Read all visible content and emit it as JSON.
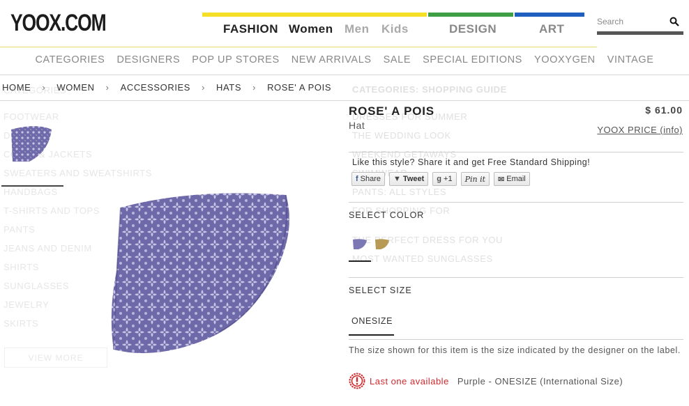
{
  "brand": {
    "logo_text": "YOOX.COM"
  },
  "topnav": {
    "fashion": "FASHION",
    "women": "Women",
    "men": "Men",
    "kids": "Kids",
    "design": "DESIGN",
    "art": "ART",
    "colors": {
      "fashion": "#f5e027",
      "design": "#3f9f46",
      "art": "#1f5fc0",
      "active": "#222222",
      "inactive": "#a9a9a9"
    }
  },
  "search": {
    "placeholder": "Search",
    "icon": "search-icon"
  },
  "catnav": [
    "CATEGORIES",
    "DESIGNERS",
    "POP UP STORES",
    "NEW ARRIVALS",
    "SALE",
    "SPECIAL EDITIONS",
    "YOOXYGEN",
    "VINTAGE"
  ],
  "breadcrumb": [
    "HOME",
    "WOMEN",
    "ACCESSORIES",
    "HATS",
    "ROSE' A POIS"
  ],
  "breadcrumb_separator": "›",
  "background_menu_left": [
    "CATEGORIES",
    "FOOTWEAR",
    "DRESSES",
    "COATS & JACKETS",
    "SWEATERS AND SWEATSHIRTS",
    "HANDBAGS",
    "T-SHIRTS AND TOPS",
    "PANTS",
    "JEANS AND DENIM",
    "SHIRTS",
    "SUNGLASSES",
    "JEWELRY",
    "SKIRTS"
  ],
  "background_view_more": "VIEW MORE",
  "background_menu_right": [
    "CATEGORIES: SHOPPING GUIDE",
    "DRESSES FOR SUMMER",
    "THE WEDDING LOOK",
    "WEEKEND GETAWAYS",
    "SWIMWEAR",
    "PANTS: ALL STYLES",
    "FOR SHOPPING FOR",
    "THE PERFECT DRESS FOR YOU",
    "MOST WANTED SUNGLASSES"
  ],
  "product": {
    "title": "ROSE' A POIS",
    "category": "Hat",
    "price": "$ 61.00",
    "price_info": "YOOX PRICE (info)",
    "share_prompt": "Like this style? Share it and get Free Standard Shipping!",
    "share_buttons": {
      "facebook": "Share",
      "twitter": "Tweet",
      "gplus": "+1",
      "pinterest": "Pin it",
      "email": "Email"
    },
    "select_color_label": "SELECT COLOR",
    "colors": [
      {
        "name": "Purple",
        "hex": "#7b78b4"
      },
      {
        "name": "Gold",
        "hex": "#b79b55"
      }
    ],
    "select_size_label": "SELECT SIZE",
    "sizes": [
      "ONESIZE"
    ],
    "size_note": "The size shown for this item is the size indicated by the designer on the label.",
    "availability": "Last one available",
    "availability_detail": "Purple - ONESIZE (International Size)"
  }
}
